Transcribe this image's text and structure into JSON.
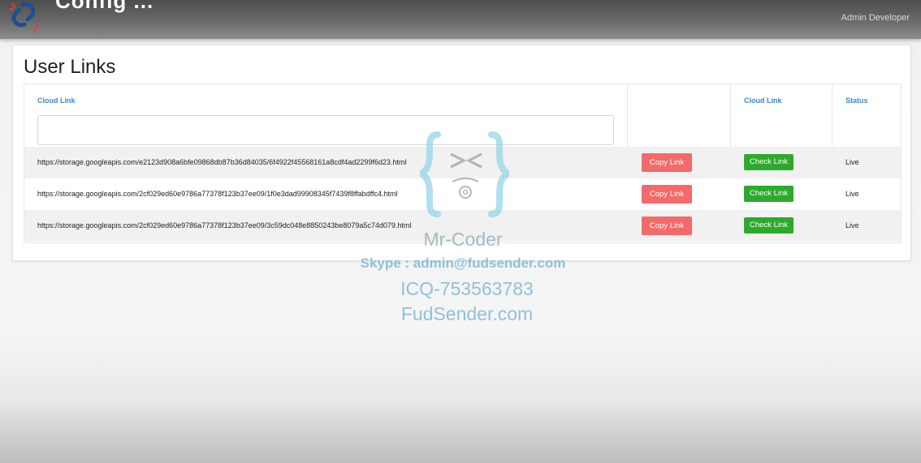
{
  "app": {
    "title": "Config ...",
    "user_name": "Admin Developer"
  },
  "page": {
    "title": "User Links"
  },
  "table": {
    "headers": {
      "cloud_link": "Cloud Link",
      "cloud_link_2": "Cloud Link",
      "status": "Status"
    },
    "filter_value": "",
    "rows": [
      {
        "url": "https://storage.googleapis.com/e2123d908a6bfe09868db87b36d84035/6f4922f45568161a8cdf4ad2299f6d23.html",
        "copy_label": "Copy Link",
        "check_label": "Check Link",
        "status": "Live"
      },
      {
        "url": "https://storage.googleapis.com/2cf029ed60e9786a77378f123b37ee09/1f0e3dad99908345f7439f8ffabdffc4.html",
        "copy_label": "Copy Link",
        "check_label": "Check Link",
        "status": "Live"
      },
      {
        "url": "https://storage.googleapis.com/2cf029ed60e9786a77378f123b37ee09/3c59dc048e8850243be8079a5c74d079.html",
        "copy_label": "Copy Link",
        "check_label": "Check Link",
        "status": "Live"
      }
    ]
  },
  "watermark": {
    "brand": "Mr-Coder",
    "skype": "Skype : admin@fudsender.com",
    "icq": "ICQ-753563783",
    "site": "FudSender.com"
  },
  "colors": {
    "copy_button": "#f26a6a",
    "check_button": "#2daa2d",
    "header_text": "#3a86d8"
  }
}
